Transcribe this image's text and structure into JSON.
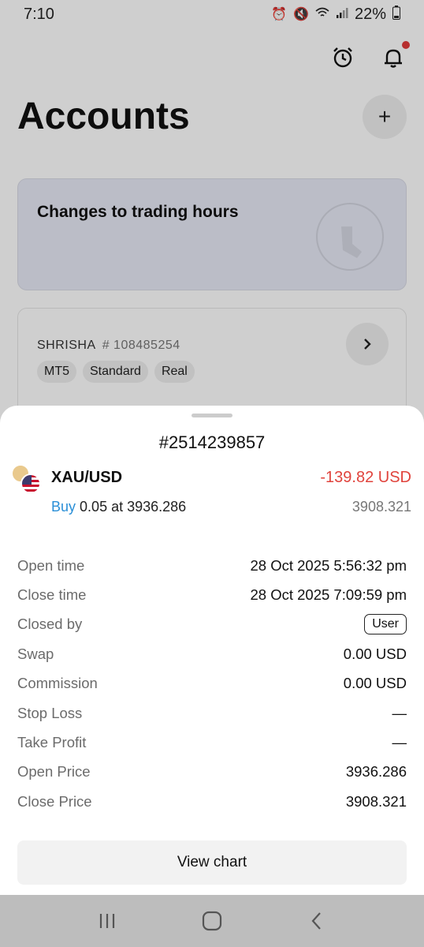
{
  "status_bar": {
    "time": "7:10",
    "battery": "22%"
  },
  "page": {
    "title": "Accounts"
  },
  "promo": {
    "title": "Changes to trading hours"
  },
  "account": {
    "name": "SHRISHA",
    "number": "# 108485254",
    "tags": [
      "MT5",
      "Standard",
      "Real"
    ]
  },
  "sheet": {
    "order_id": "#2514239857",
    "symbol": "XAU/USD",
    "profit": "-139.82 USD",
    "side": "Buy",
    "trade_detail": "0.05 at 3936.286",
    "current_price": "3908.321",
    "details": {
      "open_time": {
        "label": "Open time",
        "value": "28 Oct 2025 5:56:32 pm"
      },
      "close_time": {
        "label": "Close time",
        "value": "28 Oct 2025 7:09:59 pm"
      },
      "closed_by": {
        "label": "Closed by",
        "value": "User"
      },
      "swap": {
        "label": "Swap",
        "value": "0.00 USD"
      },
      "commission": {
        "label": "Commission",
        "value": "0.00 USD"
      },
      "stop_loss": {
        "label": "Stop Loss",
        "value": "—"
      },
      "take_profit": {
        "label": "Take Profit",
        "value": "—"
      },
      "open_price": {
        "label": "Open Price",
        "value": "3936.286"
      },
      "close_price": {
        "label": "Close Price",
        "value": "3908.321"
      }
    },
    "view_chart_label": "View chart"
  },
  "colors": {
    "loss": "#e0433c",
    "buy": "#2a8fd7",
    "promo_bg": "#e7e9f5"
  },
  "icons": {
    "alarm": "alarm-clock-icon",
    "bell": "bell-icon",
    "add": "plus-icon",
    "chevron": "chevron-right-icon"
  }
}
